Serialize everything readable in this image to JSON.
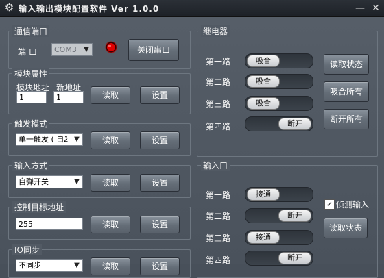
{
  "window": {
    "title": "输入输出模块配置软件 Ver 1.0.0",
    "minimize_glyph": "—",
    "close_glyph": "✕",
    "icon": "gear-icon"
  },
  "comm": {
    "group_label": "通信端口",
    "port_label": "端  口",
    "port_value": "COM3",
    "close_button": "关闭串口",
    "led_color": "#e00000"
  },
  "module": {
    "group_label": "模块属性",
    "addr_label": "模块地址",
    "new_addr_label": "新地址",
    "addr_value": "1",
    "new_addr_value": "1",
    "read_button": "读取",
    "set_button": "设置"
  },
  "trigger": {
    "group_label": "触发模式",
    "mode_value": "单一触发 ( 自ž",
    "read_button": "读取",
    "set_button": "设置"
  },
  "input_mode": {
    "group_label": "输入方式",
    "mode_value": "自弹开关",
    "read_button": "读取",
    "set_button": "设置"
  },
  "target": {
    "group_label": "控制目标地址",
    "value": "255",
    "read_button": "读取",
    "set_button": "设置"
  },
  "io_sync": {
    "group_label": "IO同步",
    "mode_value": "不同步",
    "read_button": "读取",
    "set_button": "设置"
  },
  "relay": {
    "group_label": "继电器",
    "channels": [
      {
        "label": "第一路",
        "state": "吸合",
        "on": true
      },
      {
        "label": "第二路",
        "state": "吸合",
        "on": true
      },
      {
        "label": "第三路",
        "state": "吸合",
        "on": true
      },
      {
        "label": "第四路",
        "state": "断开",
        "on": false
      }
    ],
    "read_status_button": "读取状态",
    "close_all_button": "吸合所有",
    "open_all_button": "断开所有"
  },
  "input_port": {
    "group_label": "输入口",
    "channels": [
      {
        "label": "第一路",
        "state": "接通",
        "on": true
      },
      {
        "label": "第二路",
        "state": "断开",
        "on": false
      },
      {
        "label": "第三路",
        "state": "接通",
        "on": true
      },
      {
        "label": "第四路",
        "state": "断开",
        "on": false
      }
    ],
    "detect_label": "侦测输入",
    "detect_checked": true,
    "read_status_button": "读取状态"
  }
}
